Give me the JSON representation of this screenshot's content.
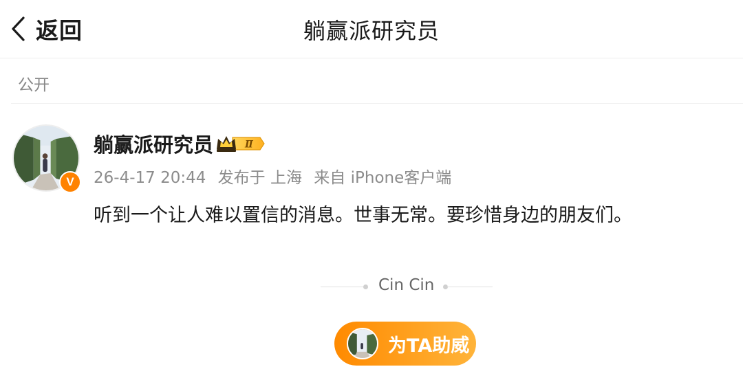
{
  "header": {
    "back_label": "返回",
    "title": "躺赢派研究员"
  },
  "visibility": "公开",
  "post": {
    "username": "躺赢派研究员",
    "verified_badge": "V",
    "level_badge": "Ⅱ",
    "date": "26-4-17 20:44",
    "location": "发布于 上海",
    "source": "来自 iPhone客户端",
    "content": "听到一个让人难以置信的消息。世事无常。要珍惜身边的朋友们。"
  },
  "signature": "Cin Cin",
  "cheer_button": {
    "label": "为TA助威"
  },
  "colors": {
    "accent": "#ff8200",
    "text_primary": "#1a1a1a",
    "text_secondary": "#8c8c8c"
  },
  "icons": {
    "back": "chevron-left-icon",
    "crown": "crown-icon"
  }
}
